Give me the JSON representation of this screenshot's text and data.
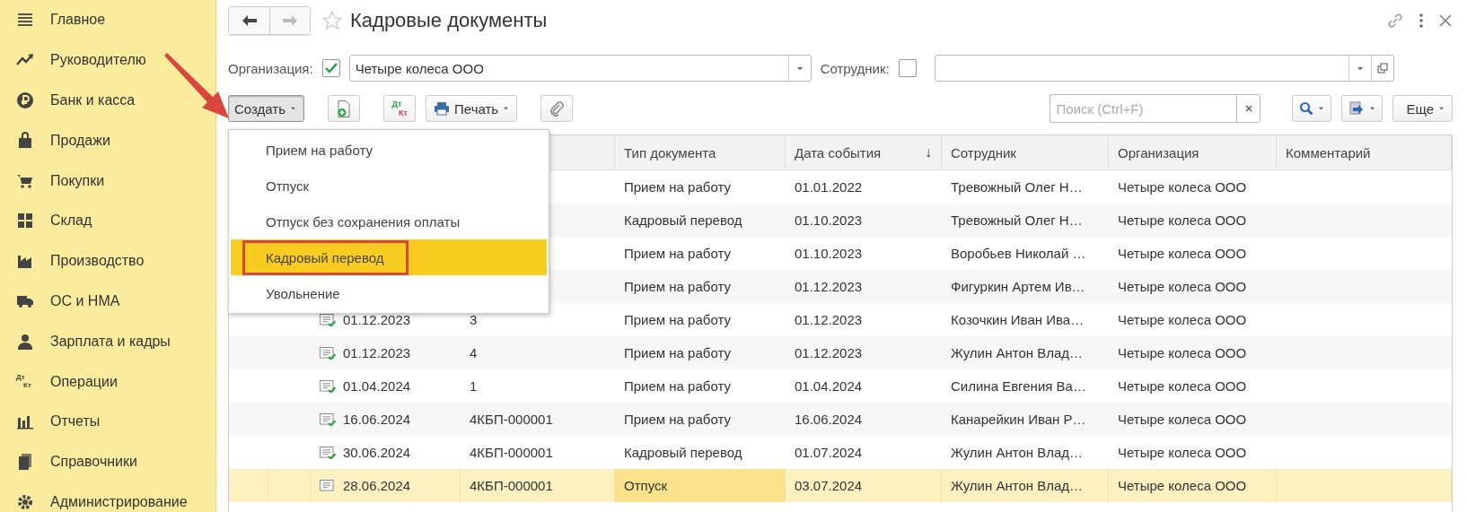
{
  "sidebar": {
    "items": [
      {
        "label": "Главное"
      },
      {
        "label": "Руководителю"
      },
      {
        "label": "Банк и касса"
      },
      {
        "label": "Продажи"
      },
      {
        "label": "Покупки"
      },
      {
        "label": "Склад"
      },
      {
        "label": "Производство"
      },
      {
        "label": "ОС и НМА"
      },
      {
        "label": "Зарплата и кадры"
      },
      {
        "label": "Операции",
        "icon_text": [
          "Дт",
          "Кт"
        ]
      },
      {
        "label": "Отчеты"
      },
      {
        "label": "Справочники"
      },
      {
        "label": "Администрирование"
      }
    ]
  },
  "window": {
    "title": "Кадровые документы",
    "favorite": false
  },
  "filters": {
    "organization": {
      "label": "Организация:",
      "checked": true,
      "value": "Четыре колеса ООО"
    },
    "employee": {
      "label": "Сотрудник:",
      "checked": false
    }
  },
  "toolbar": {
    "create": {
      "label": "Создать",
      "pressed": true
    },
    "dt_kt": [
      "Дт",
      "Кт"
    ],
    "print": {
      "label": "Печать"
    },
    "search": {
      "placeholder": "Поиск (Ctrl+F)"
    },
    "more": {
      "label": "Еще"
    }
  },
  "menu": {
    "items": [
      {
        "label": "Прием на работу",
        "selected": false,
        "outlined": false
      },
      {
        "label": "Отпуск",
        "selected": false,
        "outlined": false
      },
      {
        "label": "Отпуск без сохранения оплаты",
        "selected": false,
        "outlined": false
      },
      {
        "label": "Кадровый перевод",
        "selected": true,
        "outlined": true
      },
      {
        "label": "Увольнение",
        "selected": false,
        "outlined": false
      }
    ]
  },
  "table": {
    "columns": [
      {
        "label": "Тип документа"
      },
      {
        "label": "Дата события",
        "sort": "↓"
      },
      {
        "label": "Сотрудник"
      },
      {
        "label": "Организация"
      },
      {
        "label": "Комментарий"
      }
    ],
    "rows": [
      {
        "type": "Прием на работу",
        "event_date": "01.01.2022",
        "employee": "Тревожный Олег Н…",
        "organization": "Четыре колеса ООО",
        "selected": false
      },
      {
        "type": "Кадровый перевод",
        "event_date": "01.10.2023",
        "employee": "Тревожный Олег Н…",
        "organization": "Четыре колеса ООО",
        "selected": false
      },
      {
        "type": "Прием на работу",
        "event_date": "01.10.2023",
        "employee": "Воробьев Николай …",
        "organization": "Четыре колеса ООО",
        "selected": false
      },
      {
        "type": "Прием на работу",
        "event_date": "01.12.2023",
        "employee": "Фигуркин Артем Ив…",
        "organization": "Четыре колеса ООО",
        "selected": false
      },
      {
        "posted": true,
        "date": "01.12.2023",
        "number": "3",
        "type": "Прием на работу",
        "event_date": "01.12.2023",
        "employee": "Козочкин Иван Ива…",
        "organization": "Четыре колеса ООО",
        "selected": false
      },
      {
        "posted": true,
        "date": "01.12.2023",
        "number": "4",
        "type": "Прием на работу",
        "event_date": "01.12.2023",
        "employee": "Жулин Антон Влад…",
        "organization": "Четыре колеса ООО",
        "selected": false
      },
      {
        "posted": true,
        "date": "01.04.2024",
        "number": "1",
        "type": "Прием на работу",
        "event_date": "01.04.2024",
        "employee": "Силина Евгения Ва…",
        "organization": "Четыре колеса ООО",
        "selected": false
      },
      {
        "posted": true,
        "date": "16.06.2024",
        "number": "4КБП-000001",
        "type": "Прием на работу",
        "event_date": "16.06.2024",
        "employee": "Канарейкин Иван Р…",
        "organization": "Четыре колеса ООО",
        "selected": false
      },
      {
        "posted": true,
        "date": "30.06.2024",
        "number": "4КБП-000001",
        "type": "Кадровый перевод",
        "event_date": "01.07.2024",
        "employee": "Жулин Антон Влад…",
        "organization": "Четыре колеса ООО",
        "selected": false
      },
      {
        "posted": false,
        "date": "28.06.2024",
        "number": "4КБП-000001",
        "type": "Отпуск",
        "event_date": "03.07.2024",
        "employee": "Жулин Антон Влад…",
        "organization": "Четыре колеса ООО",
        "selected": true
      }
    ]
  }
}
